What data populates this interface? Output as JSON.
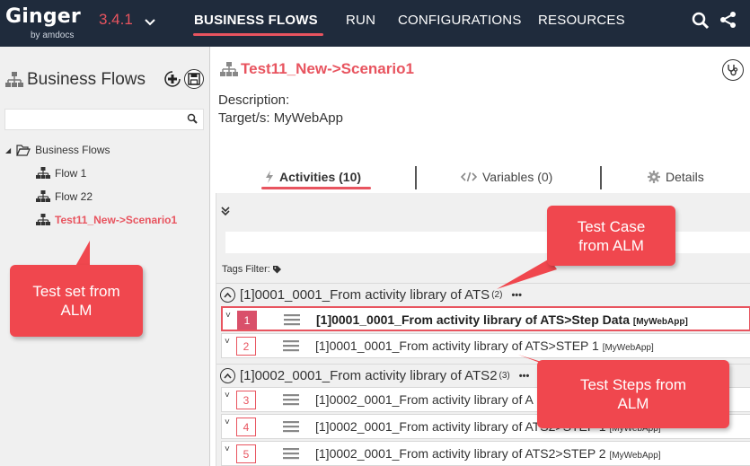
{
  "app": {
    "logo_name": "Ginger",
    "logo_sub": "by amdocs",
    "version": "3.4.1"
  },
  "nav": {
    "items": [
      "BUSINESS FLOWS",
      "RUN",
      "CONFIGURATIONS",
      "RESOURCES"
    ],
    "active": "BUSINESS FLOWS"
  },
  "left_panel": {
    "title": "Business Flows",
    "search_placeholder": "",
    "tree": {
      "root": "Business Flows",
      "items": [
        "Flow 1",
        "Flow 22",
        "Test11_New->Scenario1"
      ],
      "selected": "Test11_New->Scenario1"
    }
  },
  "main": {
    "title": "Test11_New->Scenario1",
    "description_label": "Description:",
    "target_label": "Target/s: MyWebApp",
    "tabs": [
      {
        "label": "Activities (10)",
        "icon": "bolt-icon"
      },
      {
        "label": "Variables (0)",
        "icon": "code-icon"
      },
      {
        "label": "Details",
        "icon": "gear-icon"
      }
    ],
    "active_tab": "Activities (10)",
    "tags_filter_label": "Tags Filter:",
    "groups": [
      {
        "title": "[1]0001_0001_From activity library of ATS",
        "count": "(2)",
        "more": "•••"
      },
      {
        "title": "[1]0002_0001_From activity library of ATS2",
        "count": "(3)",
        "more": "•••"
      }
    ],
    "activities": [
      {
        "num": "1",
        "text": "[1]0001_0001_From activity library of ATS>Step Data",
        "target": "[MyWebApp]"
      },
      {
        "num": "2",
        "text": "[1]0001_0001_From activity library of ATS>STEP 1",
        "target": "[MyWebApp]"
      },
      {
        "num": "3",
        "text": "[1]0002_0001_From activity library of A",
        "target": ""
      },
      {
        "num": "4",
        "text": "[1]0002_0001_From activity library of ATS2>STEP 1",
        "target": "[MyWebApp]"
      },
      {
        "num": "5",
        "text": "[1]0002_0001_From activity library of ATS2>STEP 2",
        "target": "[MyWebApp]"
      }
    ]
  },
  "callouts": {
    "test_set": "Test set from ALM",
    "test_case": "Test Case from ALM",
    "test_steps": "Test Steps from ALM"
  },
  "colors": {
    "topbar": "#1f2b3c",
    "accent": "#e8545f",
    "callout": "#f0474e",
    "panel_bg": "#f0f0f0"
  }
}
